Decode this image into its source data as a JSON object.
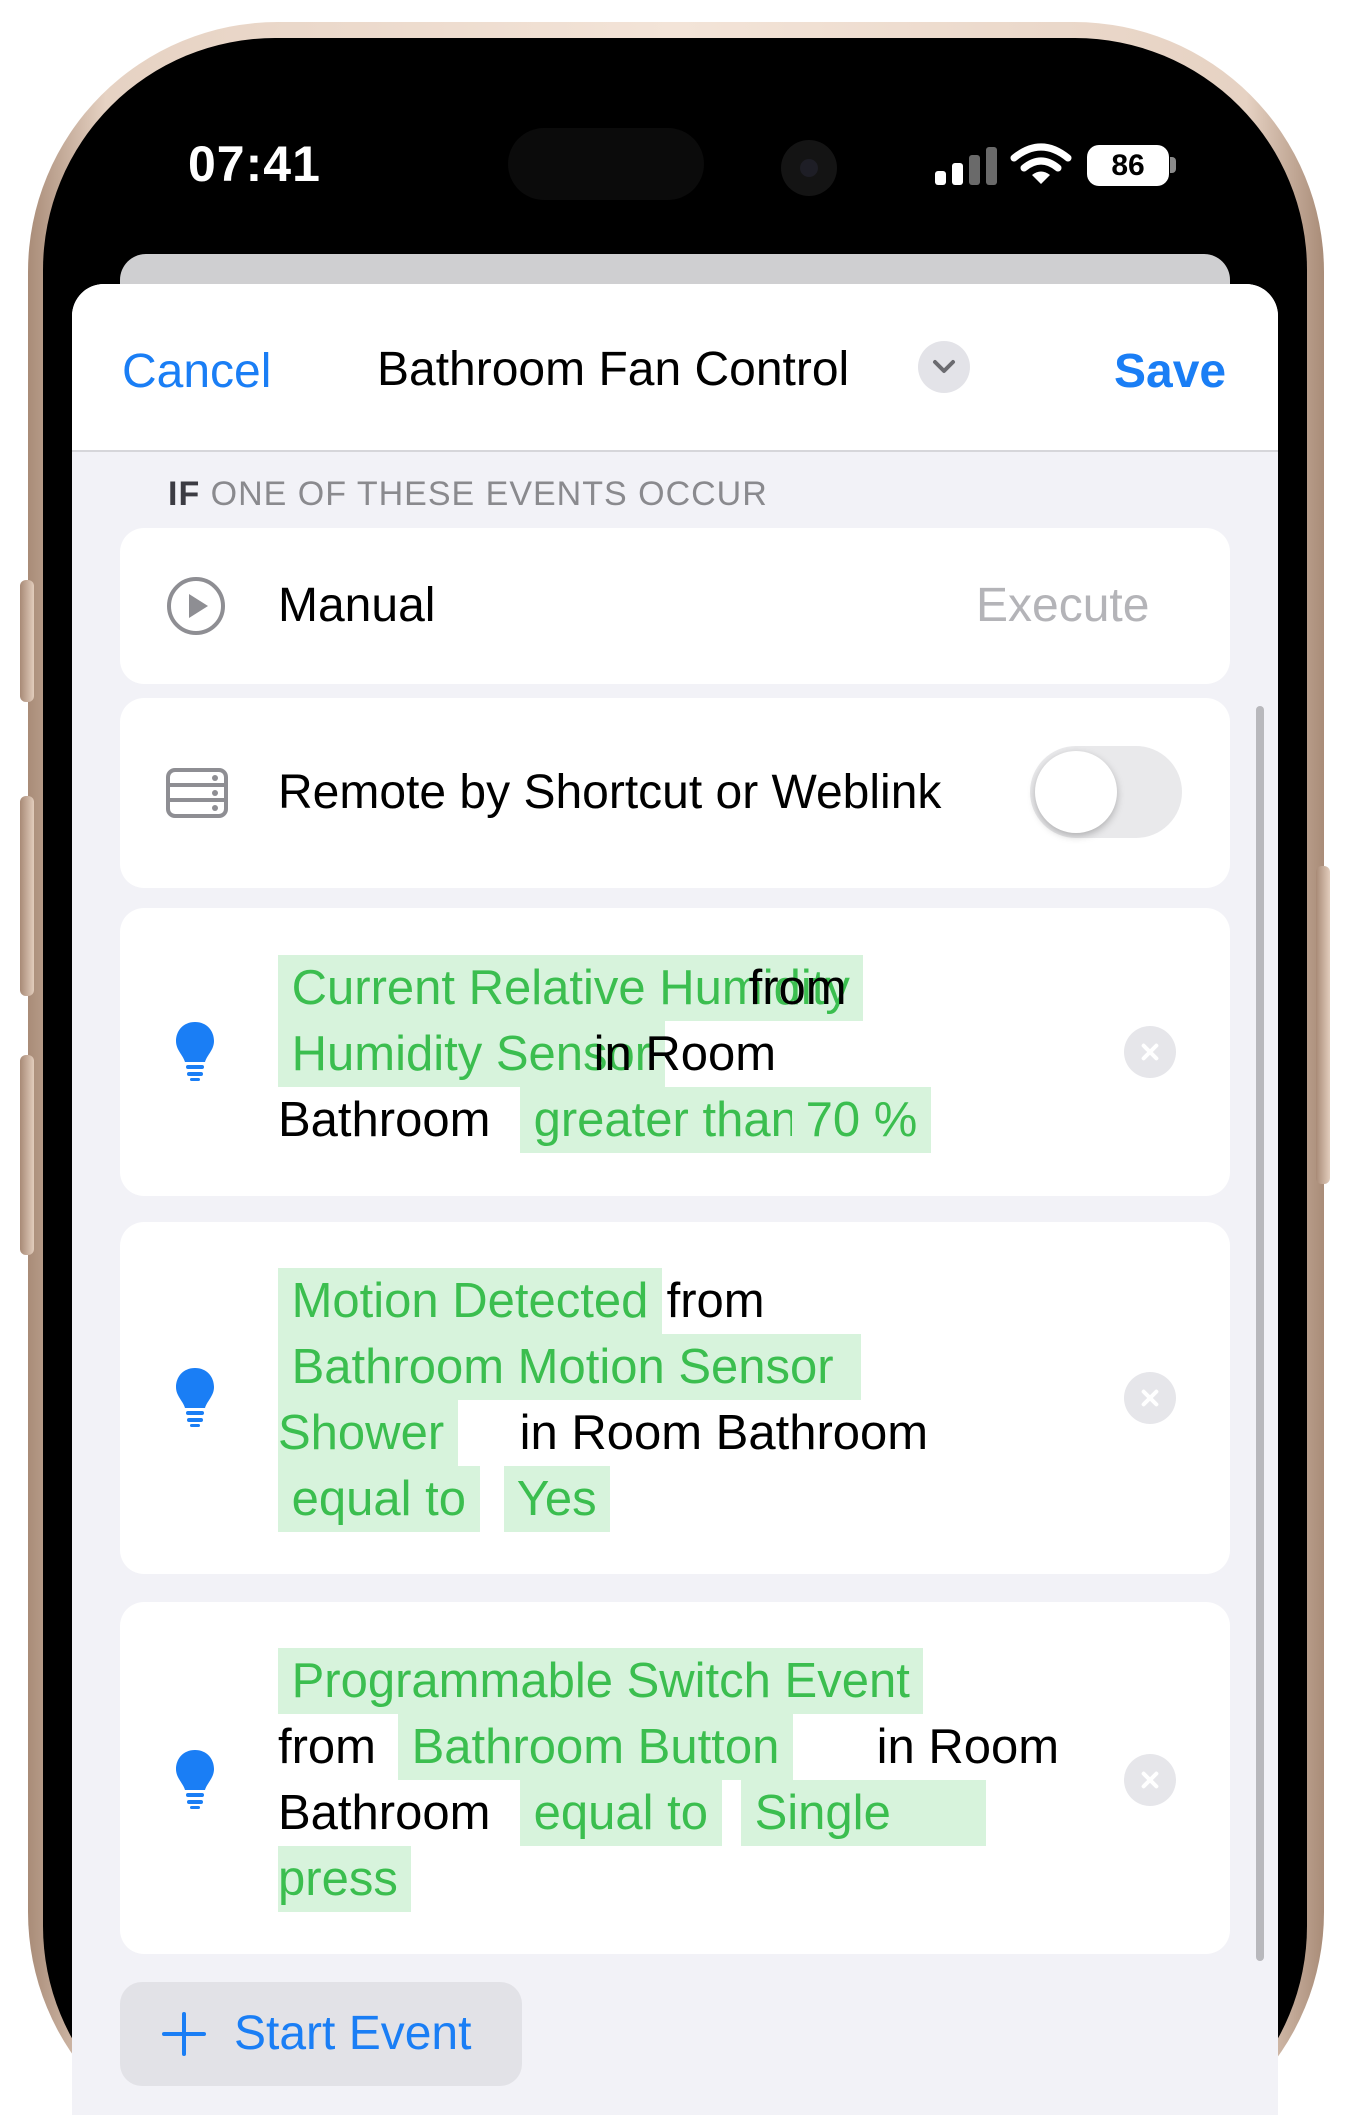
{
  "status_bar": {
    "time": "07:41",
    "battery": "86"
  },
  "nav": {
    "cancel": "Cancel",
    "title": "Bathroom Fan Control",
    "save": "Save"
  },
  "section": {
    "if": "IF",
    "rest": " ONE OF THESE EVENTS OCCUR"
  },
  "manual": {
    "label": "Manual",
    "action": "Execute"
  },
  "remote": {
    "label": "Remote by Shortcut or Weblink",
    "enabled": false
  },
  "events": [
    {
      "tokens": [
        {
          "text": " Current Relative Humidity ",
          "hl": true
        },
        {
          "text": " from",
          "hl": false
        },
        {
          "text": " Humidity Sensor ",
          "hl": true
        },
        {
          "text": " in Room",
          "hl": false
        },
        {
          "text": "Bathroom",
          "hl": false
        },
        {
          "text": " greater than ",
          "hl": true
        },
        {
          "text": " 70 % ",
          "hl": true
        }
      ]
    },
    {
      "tokens": [
        {
          "text": " Motion Detected ",
          "hl": true
        },
        {
          "text": " from",
          "hl": false
        },
        {
          "text": " Bathroom Motion Sensor  ",
          "hl": true
        },
        {
          "text": "Shower ",
          "hl": true
        },
        {
          "text": " in Room Bathroom",
          "hl": false
        },
        {
          "text": " equal to ",
          "hl": true
        },
        {
          "text": " Yes ",
          "hl": true
        }
      ]
    },
    {
      "tokens": [
        {
          "text": " Programmable Switch Event ",
          "hl": true
        },
        {
          "text": "from",
          "hl": false
        },
        {
          "text": " Bathroom Button ",
          "hl": true
        },
        {
          "text": " in Room",
          "hl": false
        },
        {
          "text": "Bathroom",
          "hl": false
        },
        {
          "text": " equal to ",
          "hl": true
        },
        {
          "text": " Single       ",
          "hl": true
        },
        {
          "text": "press ",
          "hl": true
        }
      ]
    }
  ],
  "start_event": {
    "label": "Start Event"
  },
  "colors": {
    "accent": "#1a7ef5",
    "token_green": "#3bbe4f",
    "token_bg": "#d7f3dc",
    "bulb": "#1a7ef5"
  },
  "icons": {
    "manual": "play-circle-icon",
    "remote": "server-rack-icon",
    "event": "lightbulb-icon",
    "delete": "xmark-circle-icon",
    "add": "plus-icon",
    "nav_menu": "chevron-down-icon"
  }
}
